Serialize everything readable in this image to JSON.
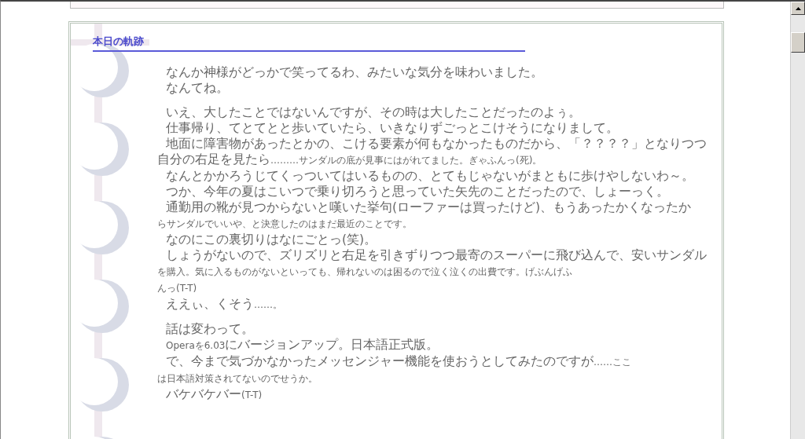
{
  "entry": {
    "title": "本日の軌跡",
    "paragraphs": [
      {
        "lines": [
          {
            "indent": true,
            "parts": [
              {
                "kind": "large",
                "text": "なんか神様がどっかで笑ってるわ、みたいな気分を味わいました。"
              }
            ]
          },
          {
            "indent": true,
            "parts": [
              {
                "kind": "large",
                "text": "なんてね。"
              }
            ]
          }
        ]
      },
      {
        "lines": [
          {
            "indent": true,
            "parts": [
              {
                "kind": "large",
                "text": "いえ、大したことではないんですが、その時は大したことだったのよぅ。"
              }
            ]
          },
          {
            "indent": true,
            "parts": [
              {
                "kind": "large",
                "text": "仕事帰り、てとてとと歩いていたら、いきなりずごっとこけそうになりまして。"
              }
            ]
          },
          {
            "indent": true,
            "parts": [
              {
                "kind": "large",
                "text": "地面に障害物があったとかの、こける要素が何もなかったものだから、「？？？？」となりつつ"
              }
            ]
          },
          {
            "indent": false,
            "parts": [
              {
                "kind": "large",
                "text": "自分の右足を見たら"
              },
              {
                "kind": "small",
                "text": "………サンダルの底が見事にはがれてました。ぎゃふんっ(死)。"
              }
            ]
          },
          {
            "indent": true,
            "parts": [
              {
                "kind": "large",
                "text": "なんとかかろうじてくっついてはいるものの、とてもじゃないがまともに歩けやしないわ～。"
              }
            ]
          },
          {
            "indent": true,
            "parts": [
              {
                "kind": "large",
                "text": "つか、今年の夏はこいつで乗り切ろうと思っていた矢先のことだったので、しょーっく。"
              }
            ]
          },
          {
            "indent": true,
            "parts": [
              {
                "kind": "large",
                "text": "通勤用の靴が見つからないと嘆いた挙句(ローファーは買ったけど)、もうあったかくなったか"
              }
            ]
          },
          {
            "indent": false,
            "parts": [
              {
                "kind": "small",
                "text": "らサンダルでいいや、と決意したのはまだ最近のことです。"
              }
            ]
          },
          {
            "indent": true,
            "parts": [
              {
                "kind": "large",
                "text": "なのにこの裏切りはなにごとっ(笑)。"
              }
            ]
          },
          {
            "indent": true,
            "parts": [
              {
                "kind": "large",
                "text": "しょうがないので、ズリズリと右足を引きずりつつ最寄のスーパーに飛び込んで、安いサンダル"
              }
            ]
          },
          {
            "indent": false,
            "parts": [
              {
                "kind": "small",
                "text": "を購入。気に入るものがないといっても、帰れないのは困るので泣く泣くの出費です。げぶんげふ"
              }
            ]
          },
          {
            "indent": false,
            "parts": [
              {
                "kind": "small",
                "text": "んっ(T-T)"
              }
            ]
          },
          {
            "indent": true,
            "parts": [
              {
                "kind": "large",
                "text": "ええぃ、くそう"
              },
              {
                "kind": "small",
                "text": "……。"
              }
            ]
          }
        ]
      },
      {
        "lines": [
          {
            "indent": true,
            "parts": [
              {
                "kind": "large",
                "text": "話は変わって。"
              }
            ]
          },
          {
            "indent": true,
            "parts": [
              {
                "kind": "small",
                "text": "Operaを6.03"
              },
              {
                "kind": "large",
                "text": "にバージョンアップ。日本語正式版。"
              }
            ]
          },
          {
            "indent": true,
            "parts": [
              {
                "kind": "large",
                "text": "で、今まで気づかなかったメッセンジャー機能を使おうとしてみたのですが"
              },
              {
                "kind": "small",
                "text": "……ここ"
              }
            ]
          },
          {
            "indent": false,
            "parts": [
              {
                "kind": "small",
                "text": "は日本語対策されてないのでせうか。"
              }
            ]
          },
          {
            "indent": true,
            "parts": [
              {
                "kind": "large",
                "text": "バケバケバー"
              },
              {
                "kind": "small",
                "text": "(T-T)"
              }
            ]
          }
        ]
      }
    ]
  }
}
